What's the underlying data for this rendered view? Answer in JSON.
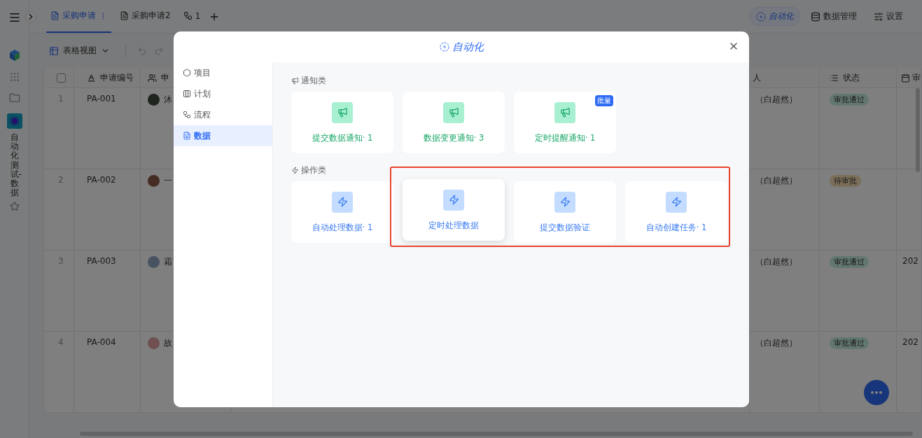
{
  "rail": {
    "title": "自动化测试-数据"
  },
  "tabs": [
    {
      "label": "采购申请",
      "kind": "doc",
      "selected": true
    },
    {
      "label": "采购申请2",
      "kind": "doc",
      "selected": false
    },
    {
      "label": "1",
      "kind": "flow",
      "selected": false
    }
  ],
  "header_actions": [
    {
      "label": "自动化",
      "kind": "automation",
      "selected": true
    },
    {
      "label": "数据管理",
      "kind": "database",
      "selected": false
    },
    {
      "label": "设置",
      "kind": "settings",
      "selected": false
    }
  ],
  "toolbar": {
    "view": "表格视图"
  },
  "table": {
    "select_all": {
      "checked": false
    },
    "columns": [
      {
        "label": "申请编号",
        "kind": "text"
      },
      {
        "label": "申",
        "kind": "person"
      },
      {
        "label": "人",
        "kind": "plain"
      },
      {
        "label": "状态",
        "kind": "list"
      },
      {
        "label": "审",
        "kind": "date"
      }
    ],
    "rows": [
      {
        "index": "1",
        "code": "PA-001",
        "name": "沐",
        "person": "（白超然）",
        "status": {
          "label": "审批通过",
          "kind": "approved"
        }
      },
      {
        "index": "2",
        "code": "PA-002",
        "name": "一",
        "person": "（白超然）",
        "status": {
          "label": "待审批",
          "kind": "pending"
        }
      },
      {
        "index": "3",
        "code": "PA-003",
        "name": "霜",
        "person": "（白超然）",
        "status": {
          "label": "审批通过",
          "kind": "approved"
        },
        "date": "202"
      },
      {
        "index": "4",
        "code": "PA-004",
        "name": "故",
        "person": "（白超然）",
        "status": {
          "label": "审批通过",
          "kind": "approved"
        },
        "date": "202"
      }
    ]
  },
  "modal": {
    "title": "自动化",
    "nav": [
      {
        "label": "项目",
        "kind": "project",
        "selected": false
      },
      {
        "label": "计划",
        "kind": "plan",
        "selected": false
      },
      {
        "label": "流程",
        "kind": "flow",
        "selected": false
      },
      {
        "label": "数据",
        "kind": "data",
        "selected": true
      }
    ],
    "sections": [
      {
        "title": "通知类",
        "kind": "notify",
        "cards": [
          {
            "label": "提交数据通知· 1",
            "hovered": false,
            "highlighted": false
          },
          {
            "label": "数据变更通知· 3",
            "hovered": false,
            "highlighted": false
          },
          {
            "label": "定时提醒通知· 1",
            "badge": "批量",
            "hovered": false,
            "highlighted": false
          }
        ]
      },
      {
        "title": "操作类",
        "kind": "action",
        "cards": [
          {
            "label": "自动处理数据· 1",
            "hovered": false,
            "highlighted": false
          },
          {
            "label": "定时处理数据",
            "hovered": true,
            "highlighted": true
          },
          {
            "label": "提交数据验证",
            "hovered": false,
            "highlighted": true
          },
          {
            "label": "自动创建任务· 1",
            "hovered": false,
            "highlighted": true
          }
        ]
      }
    ]
  }
}
